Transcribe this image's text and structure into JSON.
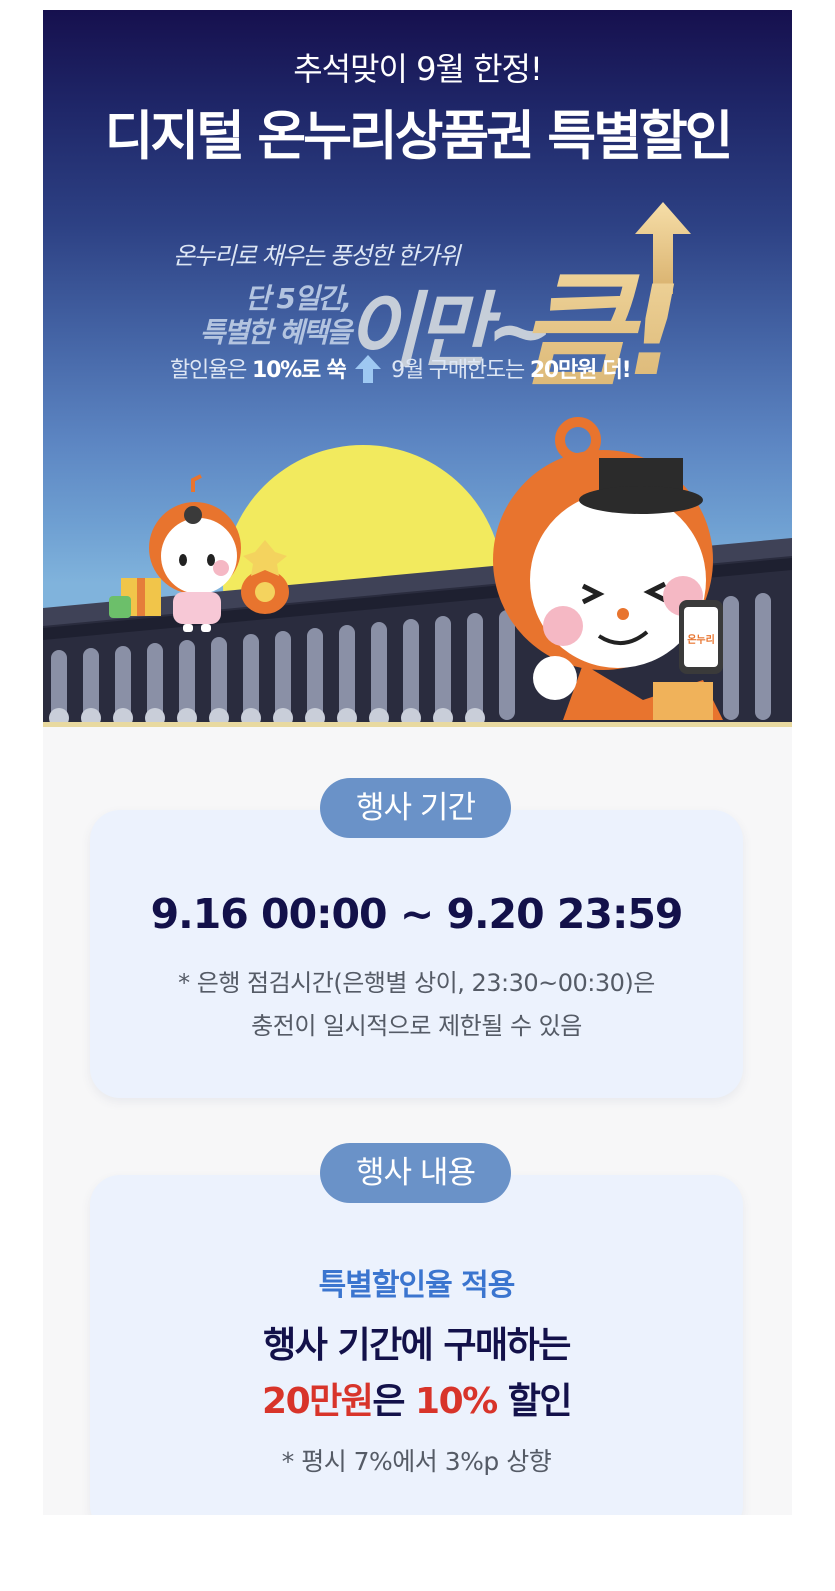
{
  "hero": {
    "subtitle": "추석맞이 9월 한정!",
    "title": "디지털 온누리상품권 특별할인",
    "slogan": "온누리로 채우는 풍성한 한가위",
    "only_line1": "단 5일간,",
    "only_line2": "특별한 혜택을",
    "big_a": "이만~",
    "big_b": "큼!",
    "rate_prefix": "할인율은",
    "rate_value": "10%로 쑥",
    "limit_prefix": "9월 구매한도는",
    "limit_value": "20만원 더!",
    "phone_logo": "온누리"
  },
  "period": {
    "badge": "행사 기간",
    "time": "9.16 00:00 ~ 9.20 23:59",
    "note_line1": "* 은행 점검시간(은행별 상이, 23:30~00:30)은",
    "note_line2": "충전이 일시적으로 제한될 수 있음"
  },
  "content": {
    "badge": "행사 내용",
    "heading": "특별할인율 적용",
    "line1": "행사 기간에 구매하는",
    "amount": "20만원",
    "line2_mid": "은 ",
    "percent": "10%",
    "line2_end": " 할인",
    "note": "* 평시 7%에서 3%p 상향"
  },
  "colors": {
    "navy": "#13114a",
    "badge_blue": "#6a92c8",
    "accent_blue": "#3b75cf",
    "accent_red": "#d8342a",
    "mascot_orange": "#e8742e",
    "moon_yellow": "#f2ea5e"
  }
}
